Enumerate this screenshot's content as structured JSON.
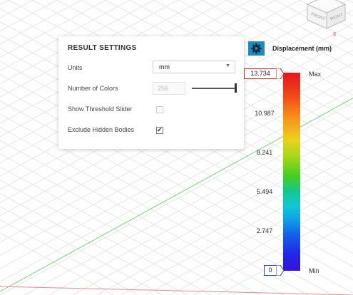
{
  "settings": {
    "title": "RESULT SETTINGS",
    "units_label": "Units",
    "units_value": "mm",
    "num_colors_label": "Number of Colors",
    "num_colors_value": "256",
    "threshold_label": "Show Threshold Slider",
    "threshold_checked": false,
    "exclude_label": "Exclude Hidden Bodies",
    "exclude_checked": true
  },
  "legend": {
    "title": "Displacement (mm)",
    "max_value": "13.734",
    "max_label": "Max",
    "ticks": [
      "10.987",
      "8.241",
      "5.494",
      "2.747"
    ],
    "min_value": "0",
    "min_label": "Min"
  },
  "viewcube": {
    "face_front": "FRONT",
    "face_right": "RIGHT",
    "close_glyph": "x"
  },
  "colors": {
    "accent": "#1e8bc3",
    "grid_axis_green": "#5ad15a",
    "grid_axis_red": "#e05050",
    "max_marker": "#dd2222",
    "min_marker": "#2244cc"
  }
}
